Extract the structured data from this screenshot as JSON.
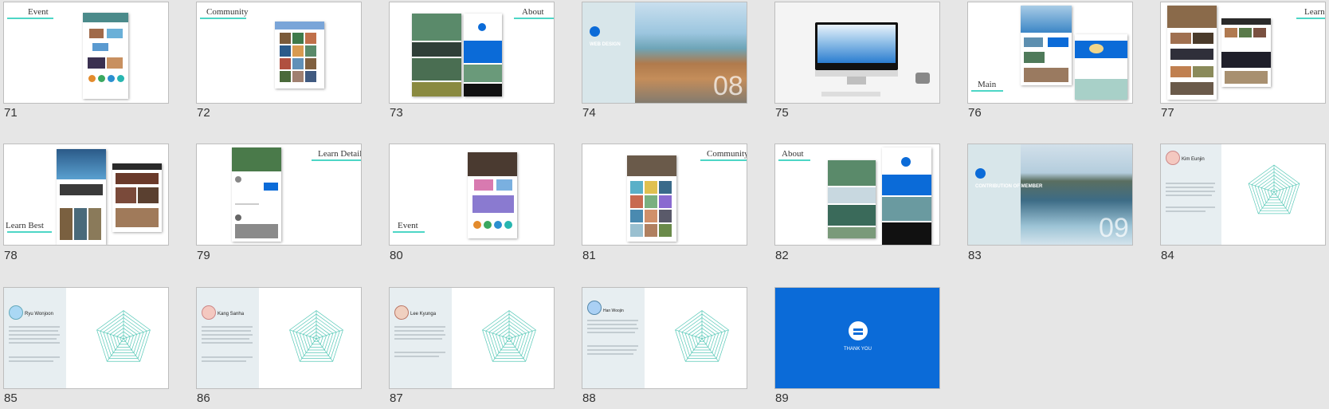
{
  "slides": [
    {
      "num": "71",
      "title": "Event"
    },
    {
      "num": "72",
      "title": "Community"
    },
    {
      "num": "73",
      "title": "About"
    },
    {
      "num": "74",
      "title": "WEB DESIGN",
      "bignum": "08"
    },
    {
      "num": "75"
    },
    {
      "num": "76",
      "title": "Main"
    },
    {
      "num": "77",
      "title": "Learn"
    },
    {
      "num": "78",
      "title": "Learn Best"
    },
    {
      "num": "79",
      "title": "Learn Detail"
    },
    {
      "num": "80",
      "title": "Event"
    },
    {
      "num": "81",
      "title": "Community"
    },
    {
      "num": "82",
      "title": "About"
    },
    {
      "num": "83",
      "title": "CONTRIBUTION OF MEMBER",
      "bignum": "09"
    },
    {
      "num": "84",
      "member": "Kim Eunjin"
    },
    {
      "num": "85",
      "member": "Ryu Wonjoon"
    },
    {
      "num": "86",
      "member": "Kang Sanha"
    },
    {
      "num": "87",
      "member": "Lee Kyunga"
    },
    {
      "num": "88",
      "member": "Han Woojin"
    },
    {
      "num": "89",
      "thanks": "THANK YOU"
    }
  ],
  "colors": {
    "accent_line": "#4dd6c6",
    "brand_blue": "#0b6bd8",
    "radar": "#59c9b8"
  }
}
